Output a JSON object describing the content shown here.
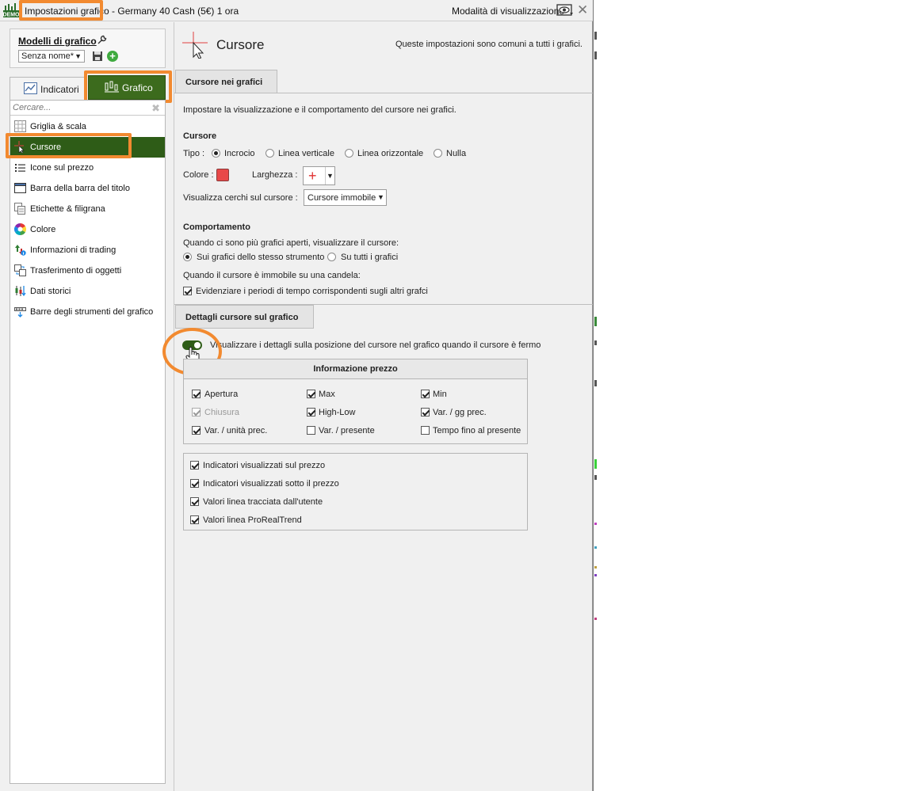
{
  "window": {
    "title": "Impostazioni grafico - Germany 40 Cash (5€) 1 ora",
    "view_mode": "Modalità di visualizzazione"
  },
  "models": {
    "title": "Modelli di grafico",
    "selected": "Senza nome*"
  },
  "tabs": {
    "indicators": "Indicatori",
    "chart": "Grafico"
  },
  "search": {
    "placeholder": "Cercare..."
  },
  "sidebar": {
    "items": [
      {
        "label": "Griglia & scala",
        "icon": "grid-icon"
      },
      {
        "label": "Cursore",
        "icon": "cursor-icon",
        "active": true
      },
      {
        "label": "Icone sul prezzo",
        "icon": "list-icon"
      },
      {
        "label": "Barra della barra del titolo",
        "icon": "window-icon"
      },
      {
        "label": "Etichette & filigrana",
        "icon": "labels-icon"
      },
      {
        "label": "Colore",
        "icon": "color-wheel-icon"
      },
      {
        "label": "Informazioni di trading",
        "icon": "trading-info-icon"
      },
      {
        "label": "Trasferimento di oggetti",
        "icon": "transfer-icon"
      },
      {
        "label": "Dati storici",
        "icon": "historical-data-icon"
      },
      {
        "label": "Barre degli strumenti del grafico",
        "icon": "toolbar-icon"
      }
    ]
  },
  "content": {
    "title": "Cursore",
    "note": "Queste impostazioni sono comuni a tutti i grafici.",
    "section1": {
      "tab": "Cursore nei grafici",
      "intro": "Impostare la visualizzazione e il comportamento del cursore nei grafici.",
      "cursor_heading": "Cursore",
      "type_label": "Tipo :",
      "types": [
        "Incrocio",
        "Linea verticale",
        "Linea orizzontale",
        "Nulla"
      ],
      "type_selected": "Incrocio",
      "color_label": "Colore :",
      "color": "#e84848",
      "width_label": "Larghezza :",
      "circles_label": "Visualizza cerchi sul cursore :",
      "circles_value": "Cursore immobile",
      "behavior_heading": "Comportamento",
      "multi_question": "Quando ci sono più grafici aperti, visualizzare il cursore:",
      "multi_options": [
        "Sui grafici dello stesso strumento",
        "Su tutti i grafici"
      ],
      "multi_selected": "Sui grafici dello stesso strumento",
      "still_question": "Quando il cursore è immobile su una candela:",
      "still_option": "Evidenziare i periodi di tempo corrispondenti sugli altri grafci",
      "still_checked": true
    },
    "section2": {
      "tab": "Dettagli cursore sul grafico",
      "toggle_label": "Visualizzare i dettagli sulla posizione del cursore nel grafico quando il cursore è fermo",
      "toggle_on": true,
      "price_info_title": "Informazione prezzo",
      "price_info": [
        {
          "label": "Apertura",
          "checked": true
        },
        {
          "label": "Max",
          "checked": true
        },
        {
          "label": "Min",
          "checked": true
        },
        {
          "label": "Chiusura",
          "checked": true,
          "disabled": true
        },
        {
          "label": "High-Low",
          "checked": true
        },
        {
          "label": "Var. / gg prec.",
          "checked": true
        },
        {
          "label": "Var. / unità prec.",
          "checked": true
        },
        {
          "label": "Var. / presente",
          "checked": false
        },
        {
          "label": "Tempo fino al presente",
          "checked": false
        }
      ],
      "extras": [
        {
          "label": "Indicatori visualizzati sul prezzo",
          "checked": true
        },
        {
          "label": "Indicatori visualizzati sotto il prezzo",
          "checked": true
        },
        {
          "label": "Valori linea tracciata dall'utente",
          "checked": true
        },
        {
          "label": "Valori linea ProRealTrend",
          "checked": true
        }
      ]
    }
  },
  "colors": {
    "accent_green": "#2e5c17",
    "highlight_orange": "#f28a30"
  }
}
